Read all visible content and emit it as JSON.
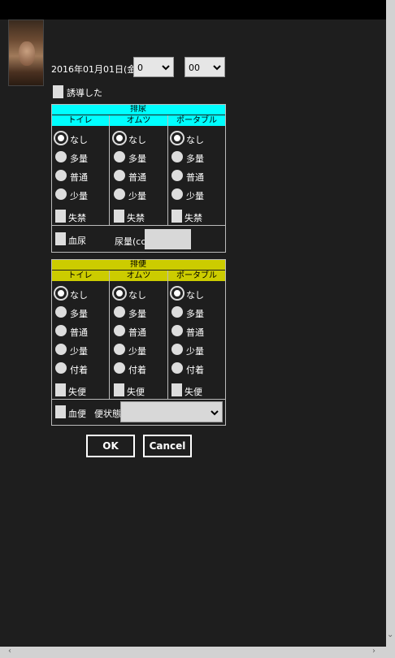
{
  "header": {
    "date": "2016年01月01日(金)",
    "hour": "0",
    "minute": "00",
    "guided_label": "誘導した"
  },
  "urination": {
    "title": "排尿",
    "color": "#00ffff",
    "columns": [
      "トイレ",
      "オムツ",
      "ポータブル"
    ],
    "options": [
      "なし",
      "多量",
      "普通",
      "少量"
    ],
    "selected": "なし",
    "incontinence_label": "失禁",
    "blood_label": "血尿",
    "volume_label": "尿量(cc)",
    "volume_value": ""
  },
  "defecation": {
    "title": "排便",
    "color": "#cccc00",
    "columns": [
      "トイレ",
      "オムツ",
      "ポータブル"
    ],
    "options": [
      "なし",
      "多量",
      "普通",
      "少量",
      "付着"
    ],
    "selected": "なし",
    "incontinence_label": "失便",
    "blood_label": "血便",
    "stool_label": "便状態",
    "stool_value": ""
  },
  "buttons": {
    "ok": "OK",
    "cancel": "Cancel"
  }
}
